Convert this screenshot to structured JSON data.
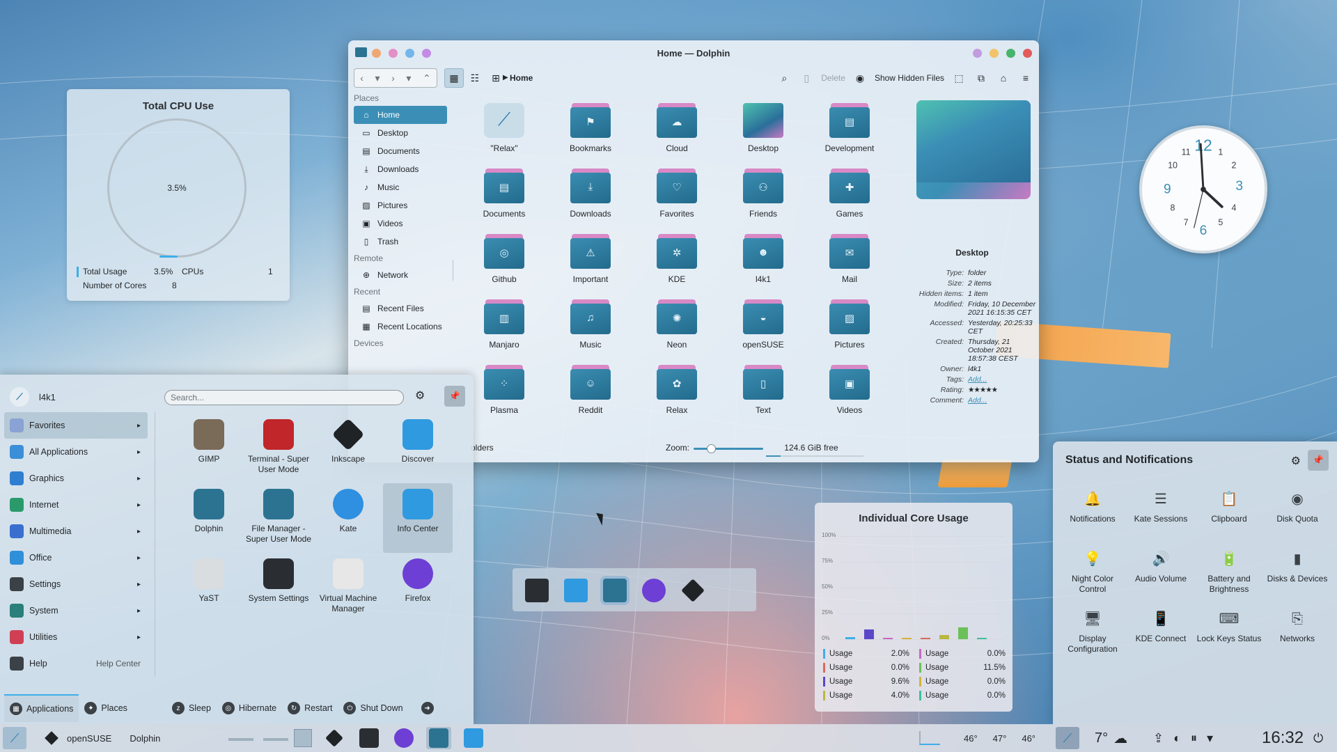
{
  "cpu_widget": {
    "title": "Total CPU Use",
    "percent": "3.5%",
    "total_usage_label": "Total Usage",
    "total_usage_value": "3.5%",
    "cpus_label": "CPUs",
    "cpus_value": "1",
    "cores_label": "Number of Cores",
    "cores_value": "8",
    "usage_fraction": 0.035
  },
  "dolphin": {
    "title": "Home — Dolphin",
    "breadcrumb": "Home",
    "toolbar": {
      "delete": "Delete",
      "hidden_files": "Show Hidden Files"
    },
    "places": [
      {
        "type": "section",
        "label": "Places"
      },
      {
        "type": "item",
        "label": "Home",
        "icon": "home-icon",
        "selected": true
      },
      {
        "type": "item",
        "label": "Desktop",
        "icon": "desktop-icon"
      },
      {
        "type": "item",
        "label": "Documents",
        "icon": "documents-icon"
      },
      {
        "type": "item",
        "label": "Downloads",
        "icon": "downloads-icon"
      },
      {
        "type": "item",
        "label": "Music",
        "icon": "music-icon"
      },
      {
        "type": "item",
        "label": "Pictures",
        "icon": "pictures-icon"
      },
      {
        "type": "item",
        "label": "Videos",
        "icon": "videos-icon"
      },
      {
        "type": "item",
        "label": "Trash",
        "icon": "trash-icon"
      },
      {
        "type": "section",
        "label": "Remote"
      },
      {
        "type": "item",
        "label": "Network",
        "icon": "network-icon"
      },
      {
        "type": "section",
        "label": "Recent"
      },
      {
        "type": "item",
        "label": "Recent Files",
        "icon": "recent-files-icon"
      },
      {
        "type": "item",
        "label": "Recent Locations",
        "icon": "recent-locations-icon"
      },
      {
        "type": "section",
        "label": "Devices"
      }
    ],
    "files": [
      {
        "name": "\"Relax\"",
        "icon": "relax-file-icon"
      },
      {
        "name": "Bookmarks",
        "icon": "bookmark-icon"
      },
      {
        "name": "Cloud",
        "icon": "cloud-icon"
      },
      {
        "name": "Desktop",
        "icon": "desktop-folder-icon"
      },
      {
        "name": "Development",
        "icon": "development-icon"
      },
      {
        "name": "Documents",
        "icon": "documents-icon"
      },
      {
        "name": "Downloads",
        "icon": "downloads-icon"
      },
      {
        "name": "Favorites",
        "icon": "heart-icon"
      },
      {
        "name": "Friends",
        "icon": "friends-icon"
      },
      {
        "name": "Games",
        "icon": "gamepad-icon"
      },
      {
        "name": "Github",
        "icon": "github-icon"
      },
      {
        "name": "Important",
        "icon": "warning-icon"
      },
      {
        "name": "KDE",
        "icon": "kde-icon"
      },
      {
        "name": "l4k1",
        "icon": "user-folder-icon"
      },
      {
        "name": "Mail",
        "icon": "mail-icon"
      },
      {
        "name": "Manjaro",
        "icon": "manjaro-icon"
      },
      {
        "name": "Music",
        "icon": "music-icon"
      },
      {
        "name": "Neon",
        "icon": "neon-icon"
      },
      {
        "name": "openSUSE",
        "icon": "opensuse-icon"
      },
      {
        "name": "Pictures",
        "icon": "pictures-icon"
      },
      {
        "name": "Plasma",
        "icon": "plasma-icon"
      },
      {
        "name": "Reddit",
        "icon": "reddit-icon"
      },
      {
        "name": "Relax",
        "icon": "relax-icon"
      },
      {
        "name": "Text",
        "icon": "text-icon"
      },
      {
        "name": "Videos",
        "icon": "videos-icon"
      }
    ],
    "info": {
      "name": "Desktop",
      "props": [
        {
          "k": "Type:",
          "v": "folder"
        },
        {
          "k": "Size:",
          "v": "2 items"
        },
        {
          "k": "Hidden items:",
          "v": "1 item"
        },
        {
          "k": "Modified:",
          "v": "Friday, 10 December 2021 16:15:35 CET"
        },
        {
          "k": "Accessed:",
          "v": "Yesterday, 20:25:33 CET"
        },
        {
          "k": "Created:",
          "v": "Thursday, 21 October 2021 18:57:38 CEST"
        },
        {
          "k": "Owner:",
          "v": "l4k1"
        },
        {
          "k": "Tags:",
          "v": "Add...",
          "link": true
        },
        {
          "k": "Rating:",
          "v": "★★★★★",
          "stars": true
        },
        {
          "k": "Comment:",
          "v": "Add...",
          "link": true
        }
      ]
    },
    "status": {
      "folders": "olders",
      "zoom_label": "Zoom:",
      "free": "124.6 GiB free",
      "zoom_fraction": 0.25,
      "used_fraction": 0.15
    }
  },
  "launcher": {
    "user": "l4k1",
    "search_placeholder": "Search...",
    "categories": [
      {
        "label": "Favorites",
        "color": "#8aa3d4",
        "arrow": true,
        "selected": true
      },
      {
        "label": "All Applications",
        "color": "#3b8fd8",
        "arrow": true
      },
      {
        "label": "Graphics",
        "color": "#2f7fd0",
        "arrow": true
      },
      {
        "label": "Internet",
        "color": "#2b9a6a",
        "arrow": true
      },
      {
        "label": "Multimedia",
        "color": "#3a6fd0",
        "arrow": true
      },
      {
        "label": "Office",
        "color": "#2f8fd8",
        "arrow": true
      },
      {
        "label": "Settings",
        "color": "#3a4147",
        "arrow": true
      },
      {
        "label": "System",
        "color": "#2a7f7a",
        "arrow": true
      },
      {
        "label": "Utilities",
        "color": "#d04054",
        "arrow": true
      },
      {
        "label": "Help",
        "color": "#3a4147",
        "extra": "Help Center"
      }
    ],
    "apps": [
      {
        "label": "GIMP",
        "icon": "gimp-icon",
        "color": "#7a6a58"
      },
      {
        "label": "Terminal - Super User Mode",
        "icon": "terminal-icon",
        "color": "#c0262a"
      },
      {
        "label": "Inkscape",
        "icon": "inkscape-icon",
        "color": "#1f2326"
      },
      {
        "label": "Discover",
        "icon": "discover-icon",
        "color": "#2f9ae0"
      },
      {
        "label": "Dolphin",
        "icon": "dolphin-icon",
        "color": "#2c7392"
      },
      {
        "label": "File Manager - Super User Mode",
        "icon": "file-manager-icon",
        "color": "#2c7392"
      },
      {
        "label": "Kate",
        "icon": "kate-icon",
        "color": "#2f8fe0"
      },
      {
        "label": "Info Center",
        "icon": "info-icon",
        "color": "#2f9ae0",
        "selected": true
      },
      {
        "label": "YaST",
        "icon": "yast-icon",
        "color": "#d9dde0"
      },
      {
        "label": "System Settings",
        "icon": "settings-icon",
        "color": "#2a2e32"
      },
      {
        "label": "Virtual Machine Manager",
        "icon": "vm-icon",
        "color": "#e7e7e7"
      },
      {
        "label": "Firefox",
        "icon": "firefox-icon",
        "color": "#6d3fd4"
      }
    ],
    "bottom": {
      "applications": "Applications",
      "places": "Places",
      "sleep": "Sleep",
      "hibernate": "Hibernate",
      "restart": "Restart",
      "shutdown": "Shut Down"
    }
  },
  "core_widget": {
    "title": "Individual Core Usage",
    "y_ticks": [
      "100%",
      "75%",
      "50%",
      "25%",
      "0%"
    ],
    "cores": [
      {
        "label": "Usage",
        "value": "2.0%",
        "num": 2.0,
        "color": "#3daee9"
      },
      {
        "label": "Usage",
        "value": "9.6%",
        "num": 9.6,
        "color": "#5a48c8"
      },
      {
        "label": "Usage",
        "value": "0.0%",
        "num": 0.0,
        "color": "#c968c0"
      },
      {
        "label": "Usage",
        "value": "0.0%",
        "num": 0.0,
        "color": "#d4b43a"
      },
      {
        "label": "Usage",
        "value": "0.0%",
        "num": 0.0,
        "color": "#d96b5a"
      },
      {
        "label": "Usage",
        "value": "4.0%",
        "num": 4.0,
        "color": "#b8b840"
      },
      {
        "label": "Usage",
        "value": "11.5%",
        "num": 11.5,
        "color": "#6cc05a"
      },
      {
        "label": "Usage",
        "value": "0.0%",
        "num": 0.0,
        "color": "#3fbf9f"
      }
    ]
  },
  "status_panel": {
    "title": "Status and Notifications",
    "items": [
      {
        "label": "Notifications",
        "icon": "bell-icon",
        "glyph": "🔔"
      },
      {
        "label": "Kate Sessions",
        "icon": "kate-sessions-icon",
        "glyph": "☰"
      },
      {
        "label": "Clipboard",
        "icon": "clipboard-icon",
        "glyph": "📋"
      },
      {
        "label": "Disk Quota",
        "icon": "disk-quota-icon",
        "glyph": "◉"
      },
      {
        "label": "Night Color Control",
        "icon": "bulb-icon",
        "glyph": "💡"
      },
      {
        "label": "Audio Volume",
        "icon": "speaker-icon",
        "glyph": "🔊"
      },
      {
        "label": "Battery and Brightness",
        "icon": "battery-icon",
        "glyph": "🔋"
      },
      {
        "label": "Disks & Devices",
        "icon": "usb-icon",
        "glyph": "▮"
      },
      {
        "label": "Display Configuration",
        "icon": "monitor-icon",
        "glyph": "🖥"
      },
      {
        "label": "KDE Connect",
        "icon": "phone-icon",
        "glyph": "📱"
      },
      {
        "label": "Lock Keys Status",
        "icon": "keyboard-icon",
        "glyph": "⌨"
      },
      {
        "label": "Networks",
        "icon": "network-icon",
        "glyph": "⎘"
      }
    ]
  },
  "taskbar": {
    "active_app": "openSUSE",
    "active_window": "Dolphin",
    "temps": [
      "46°",
      "47°",
      "46°"
    ],
    "weather": "7°",
    "clock": "16:32"
  },
  "colors": {
    "accent": "#3daee9",
    "selection": "#3b8fb6",
    "folder": "#2c7392",
    "folder_tab": "#d889c6"
  }
}
